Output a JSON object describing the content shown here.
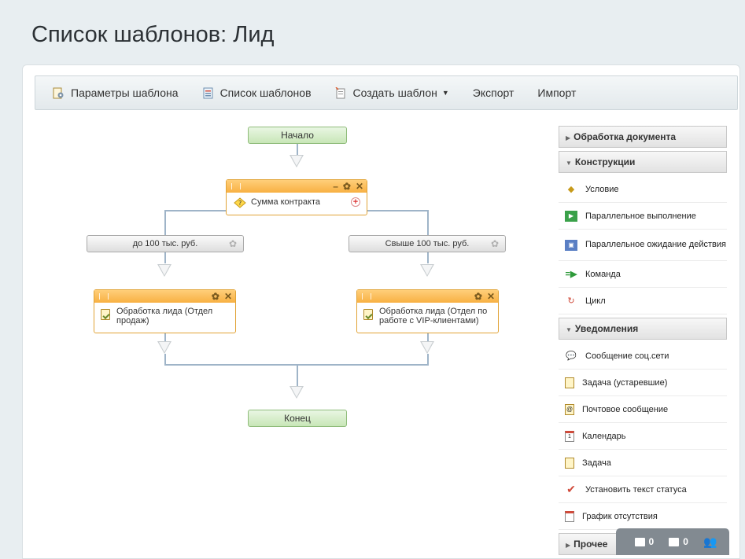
{
  "page_title": "Список шаблонов: Лид",
  "toolbar": {
    "params": "Параметры шаблона",
    "list": "Список шаблонов",
    "create": "Создать шаблон",
    "export": "Экспорт",
    "import": "Импорт"
  },
  "designer": {
    "start": "Начало",
    "condition": "Сумма контракта",
    "branch_left": "до 100 тыс. руб.",
    "branch_right": "Свыше 100 тыс. руб.",
    "action_left": "Обработка лида (Отдел продаж)",
    "action_right": "Обработка лида (Отдел по работе с VIP-клиентами)",
    "end": "Конец"
  },
  "palette": {
    "doc_processing": "Обработка документа",
    "constructs": {
      "title": "Конструкции",
      "items": [
        "Условие",
        "Параллельное выполнение",
        "Параллельное ожидание действия",
        "Команда",
        "Цикл"
      ]
    },
    "notifications": {
      "title": "Уведомления",
      "items": [
        "Сообщение соц.сети",
        "Задача (устаревшие)",
        "Почтовое сообщение",
        "Календарь",
        "Задача",
        "Установить текст статуса",
        "График отсутствия"
      ]
    },
    "other": "Прочее"
  },
  "dock": {
    "messages_count": "0",
    "notifications_count": "0"
  }
}
